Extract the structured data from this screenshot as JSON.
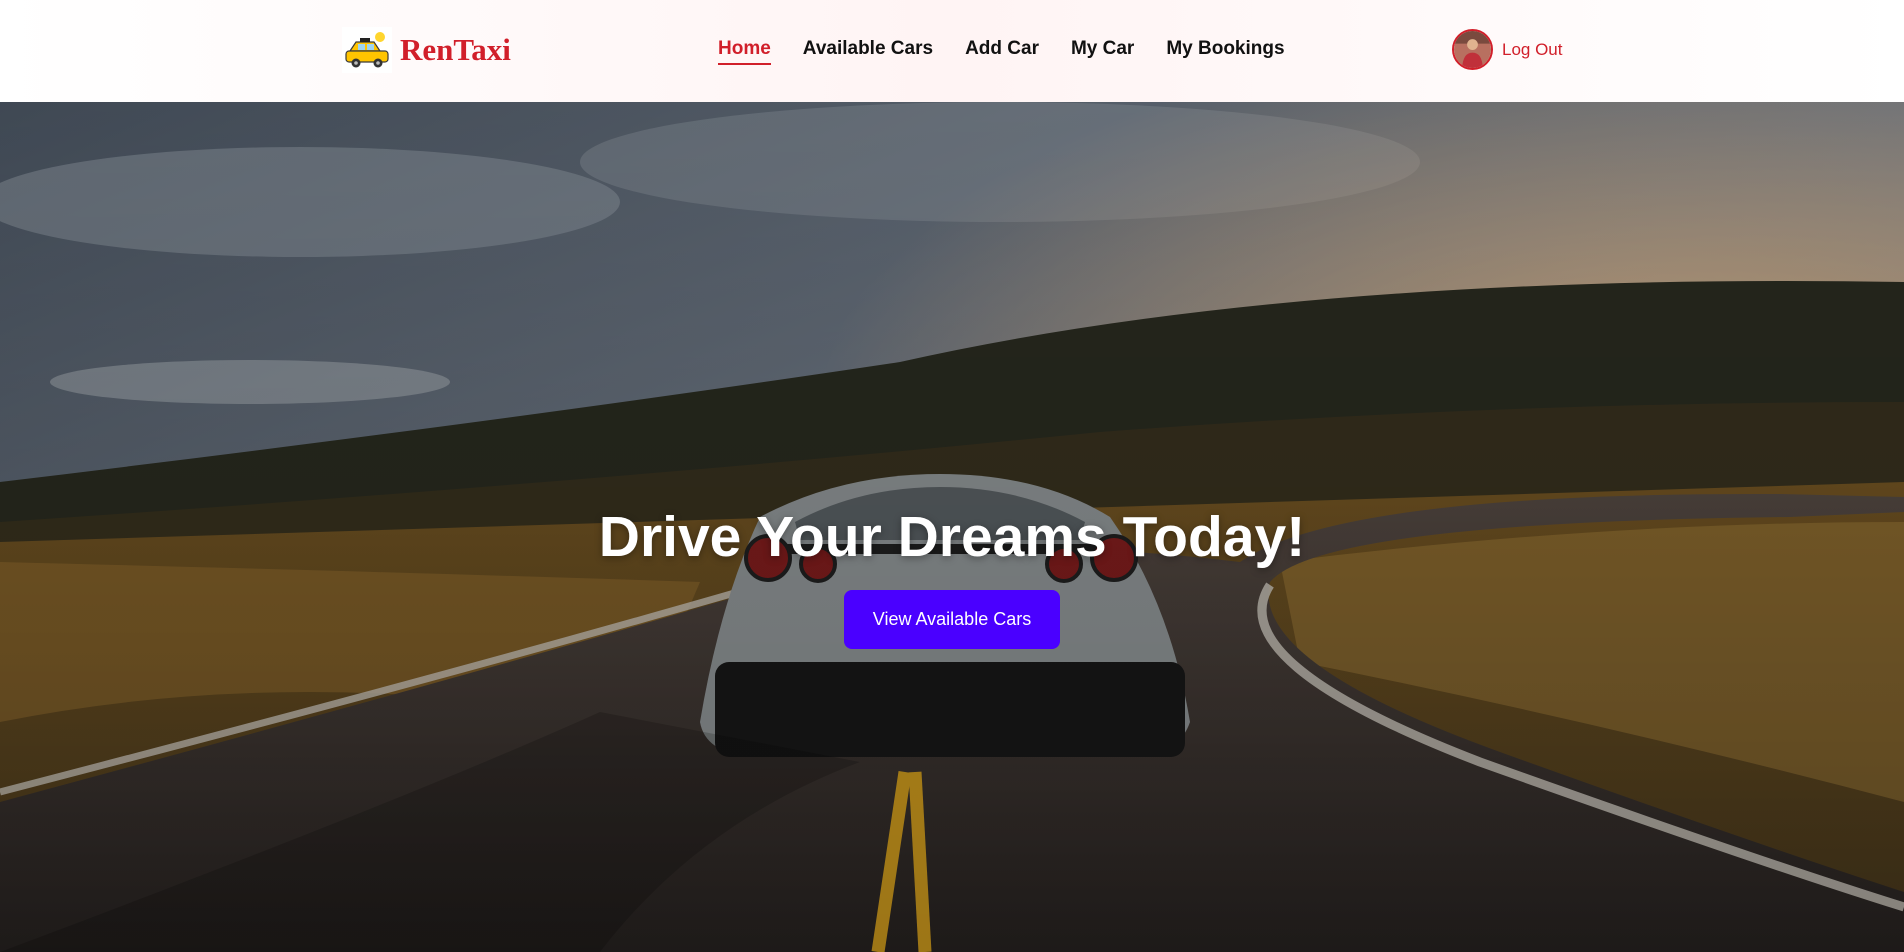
{
  "brand": {
    "name": "RenTaxi",
    "logo_icon": "yellow-taxi-icon",
    "brand_color": "#d11f2a"
  },
  "nav": {
    "items": [
      {
        "label": "Home",
        "active": true
      },
      {
        "label": "Available Cars",
        "active": false
      },
      {
        "label": "Add Car",
        "active": false
      },
      {
        "label": "My Car",
        "active": false
      },
      {
        "label": "My Bookings",
        "active": false
      }
    ]
  },
  "user": {
    "avatar_icon": "user-avatar",
    "logout_label": "Log Out"
  },
  "hero": {
    "title": "Drive Your Dreams Today!",
    "button_label": "View Available Cars",
    "button_color": "#4a00ff",
    "background": "sports car on winding road at sunset"
  }
}
